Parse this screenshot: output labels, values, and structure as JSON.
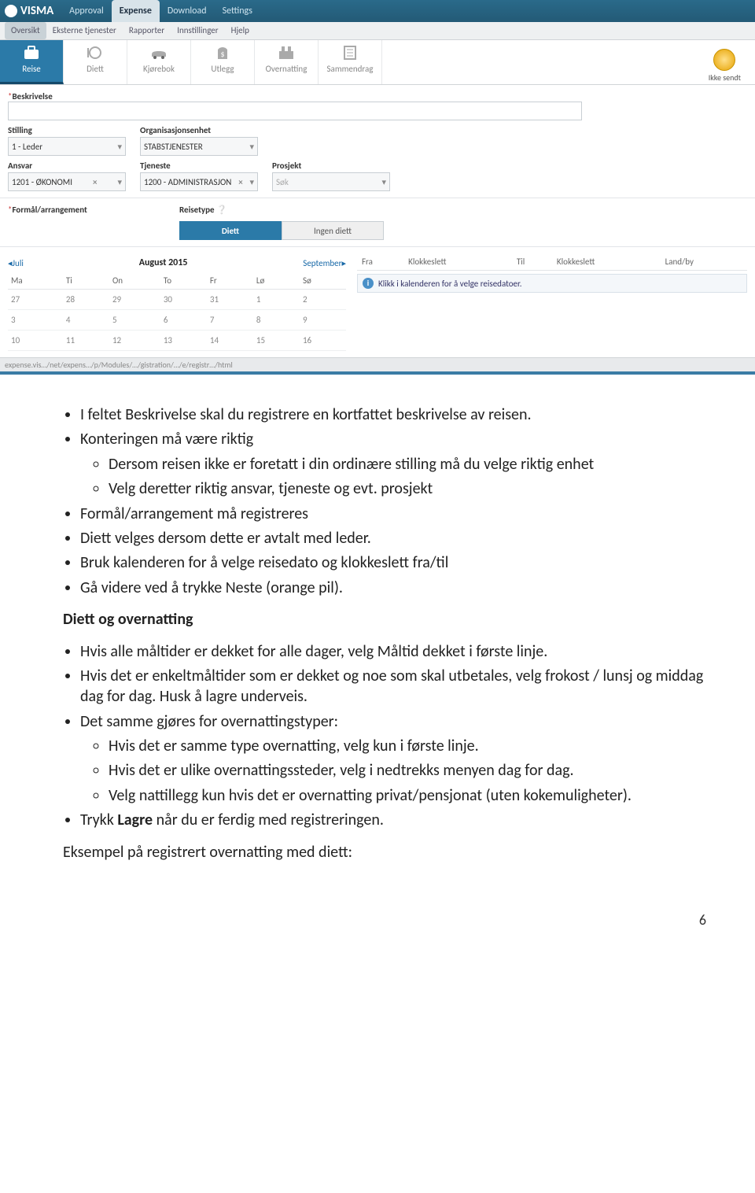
{
  "brand": "VISMA",
  "toptabs": [
    "Approval",
    "Expense",
    "Download",
    "Settings"
  ],
  "toptab_active": 1,
  "subtabs": [
    "Oversikt",
    "Eksterne tjenester",
    "Rapporter",
    "Innstillinger",
    "Hjelp"
  ],
  "subtab_active": 0,
  "steps": [
    "Reise",
    "Diett",
    "Kjørebok",
    "Utlegg",
    "Overnatting",
    "Sammendrag"
  ],
  "step_active": 0,
  "status_label": "Ikke sendt",
  "form": {
    "beskrivelse_label": "Beskrivelse",
    "stilling": {
      "label": "Stilling",
      "value": "1 - Leder"
    },
    "orgenhet": {
      "label": "Organisasjonsenhet",
      "value": "STABSTJENESTER"
    },
    "ansvar": {
      "label": "Ansvar",
      "value": "1201 - ØKONOMI"
    },
    "tjeneste": {
      "label": "Tjeneste",
      "value": "1200 - ADMINISTRASJON"
    },
    "prosjekt": {
      "label": "Prosjekt",
      "value": "Søk"
    },
    "formaal_label": "Formål/arrangement",
    "reisetype_label": "Reisetype",
    "reisetypes": [
      "Diett",
      "Ingen diett"
    ],
    "reisetype_active": 0
  },
  "calendar": {
    "prev": "Juli",
    "month": "August 2015",
    "next": "September",
    "dow": [
      "Ma",
      "Ti",
      "On",
      "To",
      "Fr",
      "Lø",
      "Sø"
    ],
    "rows": [
      [
        "27",
        "28",
        "29",
        "30",
        "31",
        "1",
        "2"
      ],
      [
        "3",
        "4",
        "5",
        "6",
        "7",
        "8",
        "9"
      ],
      [
        "10",
        "11",
        "12",
        "13",
        "14",
        "15",
        "16"
      ]
    ]
  },
  "right": {
    "cols": [
      "Fra",
      "Klokkeslett",
      "Til",
      "Klokkeslett",
      "Land/by"
    ],
    "info": "Klikk i kalenderen for å velge reisedatoer."
  },
  "url": "expense.vis…/net/expens…/p/Modules/…/gistration/…/e/registr…/html",
  "doc": {
    "bullets1": [
      "I feltet Beskrivelse skal du registrere en kortfattet beskrivelse av reisen.",
      "Konteringen må være riktig"
    ],
    "sub1": [
      "Dersom reisen ikke er foretatt i din ordinære stilling må du velge riktig enhet",
      "Velg deretter riktig ansvar, tjeneste og evt. prosjekt"
    ],
    "bullets1b": [
      "Formål/arrangement må registreres",
      "Diett velges dersom dette er avtalt med leder.",
      "Bruk kalenderen for å velge reisedato og klokkeslett fra/til",
      "Gå videre ved å trykke Neste (orange pil)."
    ],
    "heading": "Diett og overnatting",
    "bullets2": [
      "Hvis alle måltider er dekket for alle dager, velg Måltid dekket i første linje.",
      "Hvis det er enkeltmåltider som er dekket og noe som skal utbetales, velg frokost / lunsj og middag dag for dag. Husk å lagre underveis.",
      "Det samme gjøres for overnattingstyper:"
    ],
    "sub2": [
      "Hvis det er samme type overnatting, velg kun i første linje.",
      "Hvis det er ulike overnattingssteder, velg i nedtrekks menyen dag for dag.",
      "Velg nattillegg kun hvis det er overnatting privat/pensjonat (uten kokemuligheter)."
    ],
    "bullets2b_prefix": "Trykk ",
    "bullets2b_bold": "Lagre",
    "bullets2b_suffix": " når du er ferdig med registreringen.",
    "footline": "Eksempel på registrert overnatting med diett:"
  },
  "page_number": "6"
}
